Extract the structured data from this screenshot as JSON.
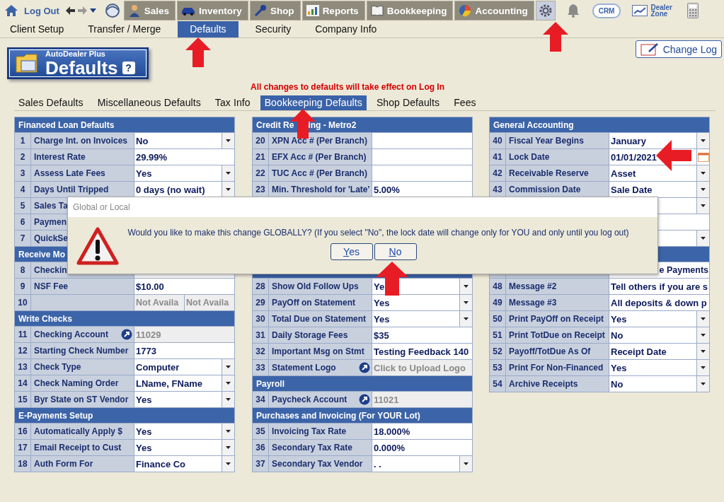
{
  "topbar": {
    "logout": "Log Out",
    "modules": [
      {
        "label": "Sales"
      },
      {
        "label": "Inventory"
      },
      {
        "label": "Shop"
      },
      {
        "label": "Reports"
      },
      {
        "label": "Bookkeeping"
      },
      {
        "label": "Accounting"
      }
    ],
    "settings": {
      "selected": true
    },
    "crm": "CRM",
    "dealer_zone": "Dealer Zone"
  },
  "subnav": [
    {
      "label": "Client Setup",
      "selected": false
    },
    {
      "label": "Transfer / Merge",
      "selected": false
    },
    {
      "label": "Defaults",
      "selected": true
    },
    {
      "label": "Security",
      "selected": false
    },
    {
      "label": "Company Info",
      "selected": false
    }
  ],
  "badge": {
    "product": "AutoDealer Plus",
    "title": "Defaults",
    "help": "?"
  },
  "notice": "All changes to defaults will take effect on Log In",
  "change_log": "Change Log",
  "tabs": [
    {
      "label": "Sales Defaults",
      "selected": false
    },
    {
      "label": "Miscellaneous Defaults",
      "selected": false
    },
    {
      "label": "Tax Info",
      "selected": false
    },
    {
      "label": "Bookkeeping Defaults",
      "selected": true
    },
    {
      "label": "Shop Defaults",
      "selected": false
    },
    {
      "label": "Fees",
      "selected": false
    }
  ],
  "columns": [
    {
      "items": [
        {
          "kind": "header",
          "title": "Financed Loan Defaults"
        },
        {
          "kind": "select",
          "num": "1",
          "label": "Charge Int. on Invoices",
          "value": "No"
        },
        {
          "kind": "text",
          "num": "2",
          "label": "Interest Rate",
          "value": "29.99%"
        },
        {
          "kind": "select",
          "num": "3",
          "label": "Assess Late Fees",
          "value": "Yes"
        },
        {
          "kind": "select",
          "num": "4",
          "label": "Days Until Tripped",
          "value": "0 days (no wait)"
        },
        {
          "kind": "covered",
          "num": "5",
          "label": "Sales Ta"
        },
        {
          "kind": "covered",
          "num": "6",
          "label": "Paymen"
        },
        {
          "kind": "covered",
          "num": "7",
          "label": "QuickSe"
        },
        {
          "kind": "header",
          "title": "Receive Mo"
        },
        {
          "kind": "covered_field",
          "num": "8",
          "label": "Checkin"
        },
        {
          "kind": "text",
          "num": "9",
          "label": "NSF Fee",
          "value": "$10.00"
        },
        {
          "kind": "split",
          "num": "10",
          "values": [
            "Not Availa",
            "Not Availa"
          ]
        },
        {
          "kind": "header",
          "title": "Write Checks"
        },
        {
          "kind": "link",
          "num": "11",
          "label": "Checking Account",
          "value": "11029"
        },
        {
          "kind": "text",
          "num": "12",
          "label": "Starting Check Number",
          "value": "1773"
        },
        {
          "kind": "select",
          "num": "13",
          "label": "Check Type",
          "value": "Computer"
        },
        {
          "kind": "select",
          "num": "14",
          "label": "Check Naming Order",
          "value": "LName, FName"
        },
        {
          "kind": "select",
          "num": "15",
          "label": "Byr State on ST Vendor",
          "value": "Yes"
        },
        {
          "kind": "header",
          "title": "E-Payments Setup"
        },
        {
          "kind": "select",
          "num": "16",
          "label": "Automatically Apply $",
          "value": "Yes"
        },
        {
          "kind": "select",
          "num": "17",
          "label": "Email Receipt to Cust",
          "value": "Yes"
        },
        {
          "kind": "select",
          "num": "18",
          "label": "Auth Form For",
          "value": "Finance Co"
        }
      ]
    },
    {
      "items": [
        {
          "kind": "header",
          "title": "Credit Re",
          "title_tail": "ing - Metro2"
        },
        {
          "kind": "text",
          "num": "20",
          "label": "XPN Acc # (Per Branch)"
        },
        {
          "kind": "text",
          "num": "21",
          "label": "EFX Acc # (Per Branch)"
        },
        {
          "kind": "text",
          "num": "22",
          "label": "TUC Acc # (Per Branch)"
        },
        {
          "kind": "text",
          "num": "23",
          "label": "Min. Threshold for 'Late'",
          "value": "5.00%"
        },
        {
          "kind": "covered"
        },
        {
          "kind": "covered"
        },
        {
          "kind": "covered"
        },
        {
          "kind": "covered"
        },
        {
          "kind": "covered_header"
        },
        {
          "kind": "select",
          "num": "28",
          "label": "Show Old Follow Ups",
          "value": "Ye"
        },
        {
          "kind": "select",
          "num": "29",
          "label": "PayOff on Statement",
          "value": "Yes"
        },
        {
          "kind": "select",
          "num": "30",
          "label": "Total Due on Statement",
          "value": "Yes"
        },
        {
          "kind": "text",
          "num": "31",
          "label": "Daily Storage Fees",
          "value": "$35"
        },
        {
          "kind": "text",
          "num": "32",
          "label": "Important Msg on Stmt",
          "value": "Testing Feedback 140"
        },
        {
          "kind": "link",
          "num": "33",
          "label": "Statement Logo",
          "value": "Click to Upload Logo"
        },
        {
          "kind": "header",
          "title": "Payroll"
        },
        {
          "kind": "link",
          "num": "34",
          "label": "Paycheck Account",
          "value": "11021"
        },
        {
          "kind": "header",
          "title": "Purchases and Invoicing (For YOUR Lot)"
        },
        {
          "kind": "text",
          "num": "35",
          "label": "Invoicing Tax Rate",
          "value": "18.000%"
        },
        {
          "kind": "text",
          "num": "36",
          "label": "Secondary Tax Rate",
          "value": "0.000%"
        },
        {
          "kind": "select",
          "num": "37",
          "label": "Secondary Tax Vendor",
          "value": ". ."
        }
      ]
    },
    {
      "items": [
        {
          "kind": "header",
          "title": "General Accounting"
        },
        {
          "kind": "select",
          "num": "40",
          "label": "Fiscal Year Begins",
          "value": "January"
        },
        {
          "kind": "date",
          "num": "41",
          "label": "Lock Date",
          "value": "01/01/2021"
        },
        {
          "kind": "select",
          "num": "42",
          "label": "Receivable Reserve",
          "value": "Asset"
        },
        {
          "kind": "select",
          "num": "43",
          "label": "Commission Date",
          "value": "Sale Date"
        },
        {
          "kind": "covered_select"
        },
        {
          "kind": "covered_field"
        },
        {
          "kind": "covered_select"
        },
        {
          "kind": "covered_header"
        },
        {
          "kind": "tail",
          "value": "e Payments"
        },
        {
          "kind": "text",
          "num": "48",
          "label": "Message #2",
          "value": "Tell others if you are s"
        },
        {
          "kind": "text",
          "num": "49",
          "label": "Message #3",
          "value": "All deposits & down p"
        },
        {
          "kind": "select",
          "num": "50",
          "label": "Print PayOff on Receipt",
          "value": "Yes"
        },
        {
          "kind": "select",
          "num": "51",
          "label": "Print TotDue on Receipt",
          "value": "No"
        },
        {
          "kind": "select",
          "num": "52",
          "label": "Payoff/TotDue As Of",
          "value": "Receipt Date"
        },
        {
          "kind": "select",
          "num": "53",
          "label": "Print For Non-Financed",
          "value": "Yes"
        },
        {
          "kind": "select",
          "num": "54",
          "label": "Archive Receipts",
          "value": "No"
        }
      ]
    }
  ],
  "dialog": {
    "title": "Global or Local",
    "message": "Would you like to make this change GLOBALLY? (If you select \"No\", the lock date will change only for YOU and only until you log out)",
    "buttons": [
      "Yes",
      "No"
    ]
  }
}
